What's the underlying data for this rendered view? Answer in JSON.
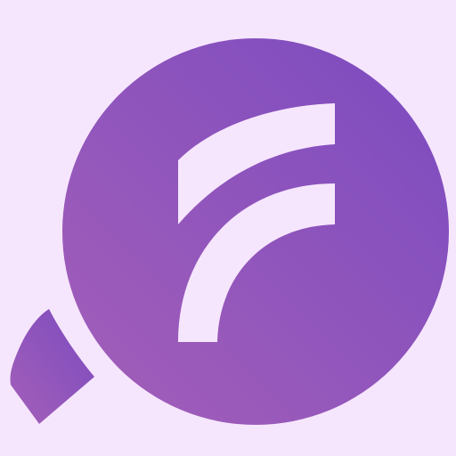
{
  "logo": {
    "icon": "magnifier-f-logo-icon",
    "colors": {
      "background": "#f6e6fd",
      "gradient_start": "#a45fb8",
      "gradient_end": "#7b4bc0",
      "mark": "#f6e6fd"
    }
  }
}
